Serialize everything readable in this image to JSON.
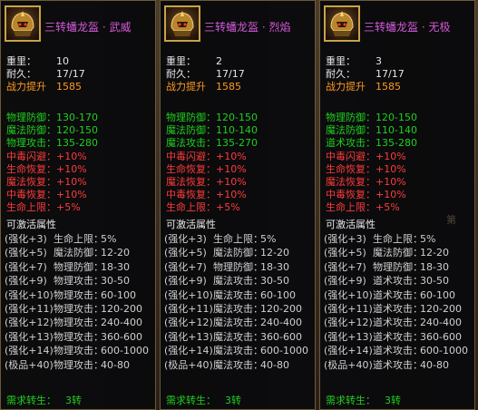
{
  "panels": [
    {
      "title": "三转蟠龙盔 · 武威",
      "weight_label": "重里：",
      "weight": "10",
      "durability_label": "耐久：",
      "durability": "17/17",
      "power_label": "战力提升",
      "power": "1585",
      "stats": [
        {
          "label": "物理防御：",
          "value": "130-170",
          "color": "green"
        },
        {
          "label": "魔法防御：",
          "value": "120-150",
          "color": "green"
        },
        {
          "label": "物理攻击：",
          "value": "135-280",
          "color": "green"
        },
        {
          "label": "中毒闪避：",
          "value": "+10%",
          "color": "red"
        },
        {
          "label": "生命恢复：",
          "value": "+10%",
          "color": "red"
        },
        {
          "label": "魔法恢复：",
          "value": "+10%",
          "color": "red"
        },
        {
          "label": "中毒恢复：",
          "value": "+10%",
          "color": "red"
        },
        {
          "label": "生命上限：",
          "value": "+5%",
          "color": "red"
        }
      ],
      "activatable_label": "可激活属性",
      "enhancements": [
        {
          "level": "(强化+3)",
          "name": "生命上限：",
          "value": "5%"
        },
        {
          "level": "(强化+5)",
          "name": "魔法防御：",
          "value": "12-20"
        },
        {
          "level": "(强化+7)",
          "name": "物理防御：",
          "value": "18-30"
        },
        {
          "level": "(强化+9)",
          "name": "物理攻击：",
          "value": "30-50"
        },
        {
          "level": "(强化+10)",
          "name": "物理攻击：",
          "value": "60-100"
        },
        {
          "level": "(强化+11)",
          "name": "物理攻击：",
          "value": "120-200"
        },
        {
          "level": "(强化+12)",
          "name": "物理攻击：",
          "value": "240-400"
        },
        {
          "level": "(强化+13)",
          "name": "物理攻击：",
          "value": "360-600"
        },
        {
          "level": "(强化+14)",
          "name": "物理攻击：",
          "value": "600-1000"
        },
        {
          "level": "(极品+40)",
          "name": "物理攻击：",
          "value": "40-80"
        }
      ],
      "requirement_label": "需求转生：",
      "requirement": "3转"
    },
    {
      "title": "三转蟠龙盔 · 烈焰",
      "weight_label": "重里：",
      "weight": "2",
      "durability_label": "耐久：",
      "durability": "17/17",
      "power_label": "战力提升",
      "power": "1585",
      "stats": [
        {
          "label": "物理防御：",
          "value": "120-150",
          "color": "green"
        },
        {
          "label": "魔法防御：",
          "value": "110-140",
          "color": "green"
        },
        {
          "label": "魔法攻击：",
          "value": "135-270",
          "color": "green"
        },
        {
          "label": "中毒闪避：",
          "value": "+10%",
          "color": "red"
        },
        {
          "label": "生命恢复：",
          "value": "+10%",
          "color": "red"
        },
        {
          "label": "魔法恢复：",
          "value": "+10%",
          "color": "red"
        },
        {
          "label": "中毒恢复：",
          "value": "+10%",
          "color": "red"
        },
        {
          "label": "生命上限：",
          "value": "+5%",
          "color": "red"
        }
      ],
      "activatable_label": "可激活属性",
      "enhancements": [
        {
          "level": "(强化+3)",
          "name": "生命上限：",
          "value": "5%"
        },
        {
          "level": "(强化+5)",
          "name": "魔法防御：",
          "value": "12-20"
        },
        {
          "level": "(强化+7)",
          "name": "物理防御：",
          "value": "18-30"
        },
        {
          "level": "(强化+9)",
          "name": "魔法攻击：",
          "value": "30-50"
        },
        {
          "level": "(强化+10)",
          "name": "魔法攻击：",
          "value": "60-100"
        },
        {
          "level": "(强化+11)",
          "name": "魔法攻击：",
          "value": "120-200"
        },
        {
          "level": "(强化+12)",
          "name": "魔法攻击：",
          "value": "240-400"
        },
        {
          "level": "(强化+13)",
          "name": "魔法攻击：",
          "value": "360-600"
        },
        {
          "level": "(强化+14)",
          "name": "魔法攻击：",
          "value": "600-1000"
        },
        {
          "level": "(极品+40)",
          "name": "魔法攻击：",
          "value": "40-80"
        }
      ],
      "requirement_label": "需求转生：",
      "requirement": "3转"
    },
    {
      "title": "三转蟠龙盔 · 无极",
      "weight_label": "重里：",
      "weight": "3",
      "durability_label": "耐久：",
      "durability": "17/17",
      "power_label": "战力提升",
      "power": "1585",
      "stats": [
        {
          "label": "物理防御：",
          "value": "120-150",
          "color": "green"
        },
        {
          "label": "魔法防御：",
          "value": "110-140",
          "color": "green"
        },
        {
          "label": "道术攻击：",
          "value": "135-280",
          "color": "green"
        },
        {
          "label": "中毒闪避：",
          "value": "+10%",
          "color": "red"
        },
        {
          "label": "生命恢复：",
          "value": "+10%",
          "color": "red"
        },
        {
          "label": "魔法恢复：",
          "value": "+10%",
          "color": "red"
        },
        {
          "label": "中毒恢复：",
          "value": "+10%",
          "color": "red"
        },
        {
          "label": "生命上限：",
          "value": "+5%",
          "color": "red"
        }
      ],
      "activatable_label": "可激活属性",
      "enhancements": [
        {
          "level": "(强化+3)",
          "name": "生命上限：",
          "value": "5%"
        },
        {
          "level": "(强化+5)",
          "name": "魔法防御：",
          "value": "12-20"
        },
        {
          "level": "(强化+7)",
          "name": "物理防御：",
          "value": "18-30"
        },
        {
          "level": "(强化+9)",
          "name": "道术攻击：",
          "value": "30-50"
        },
        {
          "level": "(强化+10)",
          "name": "道术攻击：",
          "value": "60-100"
        },
        {
          "level": "(强化+11)",
          "name": "道术攻击：",
          "value": "120-200"
        },
        {
          "level": "(强化+12)",
          "name": "道术攻击：",
          "value": "240-400"
        },
        {
          "level": "(强化+13)",
          "name": "道术攻击：",
          "value": "360-600"
        },
        {
          "level": "(强化+14)",
          "name": "道术攻击：",
          "value": "600-1000"
        },
        {
          "level": "(极品+40)",
          "name": "道术攻击：",
          "value": "40-80"
        }
      ],
      "requirement_label": "需求转生：",
      "requirement": "3转"
    }
  ],
  "background": {
    "tab_hint": "第",
    "colors": {
      "title": "#d25ad8",
      "power": "#ff9a1f",
      "green": "#1fd11f",
      "red": "#ff3b3b",
      "border": "#c8a24a"
    }
  }
}
